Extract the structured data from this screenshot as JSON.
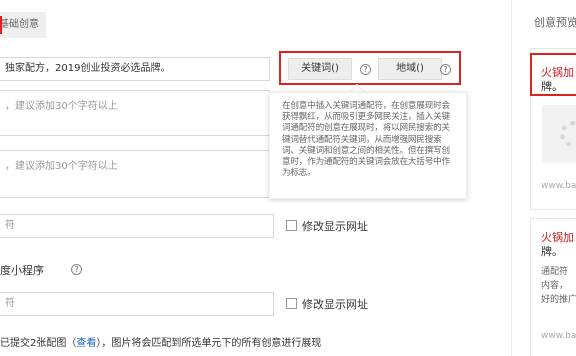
{
  "tabs": {
    "basic_creative": "基础创意"
  },
  "form": {
    "title_value": "独家配方，2019创业投资必选品牌。",
    "desc1_placeholder": "，建议添加30个字符以上",
    "desc2_placeholder": "，建议添加30个字符以上",
    "url_placeholder": "符",
    "miniapp_url_placeholder": "符",
    "keyword_button": "关键词()",
    "region_button": "地域()",
    "help_glyph": "?",
    "tooltip_text": "在创意中插入关键词通配符，在创意展现时会获得飘红，从而吸引更多网民关注，插入关键词通配符的创意在展现时，将以网民搜索的关键词替代通配符关键词，从而增强网民搜索词、关键词和创意之间的相关性。但在撰写创意时，作为通配符的关键词会放在大括号中作为标志。",
    "modify_url_label": "修改显示网址",
    "modify_url_label_2": "修改显示网址",
    "mini_program_label": "度小程序",
    "note_prefix": "已提交2张配图（",
    "note_link": "查看",
    "note_suffix": "），图片将会匹配到所选单元下的所有创意进行展现"
  },
  "preview": {
    "title": "创意预览",
    "card1_title": "火锅加",
    "card1_text": "牌。",
    "card1_url": "www.ba",
    "card2_title": "火锅加",
    "card2_text": "牌。",
    "card2_desc_line1": "通配符",
    "card2_desc_line2": "内容，",
    "card2_desc_line3": "好的推广",
    "card2_url": "www.ba"
  },
  "colors": {
    "highlight_red": "#d9251c",
    "link_blue": "#1e63c4",
    "title_red": "#c81e1e"
  }
}
